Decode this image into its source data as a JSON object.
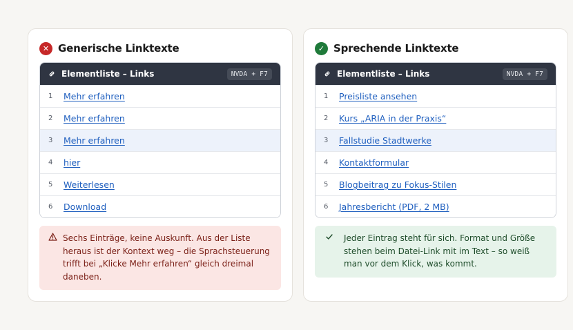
{
  "colors": {
    "bad": "#c62828",
    "good": "#1f7a3a",
    "link": "#1f5fbf",
    "header": "#2f3542"
  },
  "left": {
    "title": "Generische Linktexte",
    "status_icon": "x-icon",
    "list_title": "Elementliste – Links",
    "shortcut": "NVDA + F7",
    "items": [
      {
        "num": "1",
        "label": "Mehr erfahren"
      },
      {
        "num": "2",
        "label": "Mehr erfahren"
      },
      {
        "num": "3",
        "label": "Mehr erfahren"
      },
      {
        "num": "4",
        "label": "hier"
      },
      {
        "num": "5",
        "label": "Weiterlesen"
      },
      {
        "num": "6",
        "label": "Download"
      }
    ],
    "active_index": 2,
    "note_icon": "warning-triangle-icon",
    "note": "Sechs Einträge, keine Auskunft. Aus der Liste heraus ist der Kontext weg – die Sprachsteuerung trifft bei „Klicke Mehr erfahren“ gleich dreimal daneben."
  },
  "right": {
    "title": "Sprechende Linktexte",
    "status_icon": "check-icon",
    "list_title": "Elementliste – Links",
    "shortcut": "NVDA + F7",
    "items": [
      {
        "num": "1",
        "label": "Preisliste ansehen"
      },
      {
        "num": "2",
        "label": "Kurs „ARIA in der Praxis“"
      },
      {
        "num": "3",
        "label": "Fallstudie Stadtwerke"
      },
      {
        "num": "4",
        "label": "Kontaktformular"
      },
      {
        "num": "5",
        "label": "Blogbeitrag zu Fokus-Stilen"
      },
      {
        "num": "6",
        "label": "Jahresbericht (PDF, 2 MB)"
      }
    ],
    "active_index": 2,
    "note_icon": "check-icon",
    "note": "Jeder Eintrag steht für sich. Format und Größe stehen beim Datei-Link mit im Text – so weiß man vor dem Klick, was kommt."
  }
}
